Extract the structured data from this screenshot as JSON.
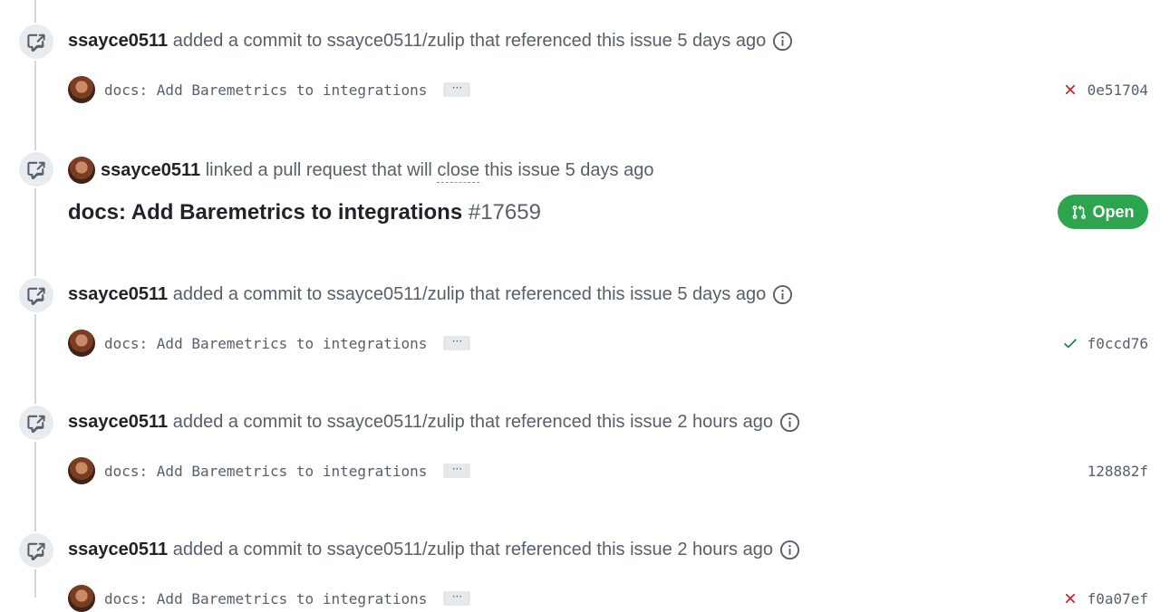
{
  "colors": {
    "success": "#2da44e",
    "danger": "#cf222e",
    "muted": "#57606a"
  },
  "events": [
    {
      "type": "commit-ref",
      "author": "ssayce0511",
      "action": "added a commit to",
      "repo": "ssayce0511/zulip",
      "suffix": "that referenced this issue",
      "time": "5 days ago",
      "commit": {
        "message": "docs: Add Baremetrics to integrations",
        "ellipsis": "···",
        "status": "failure",
        "sha": "0e51704"
      }
    },
    {
      "type": "linked-pr",
      "author": "ssayce0511",
      "action": "linked a pull request that will",
      "close_word": "close",
      "suffix": "this issue",
      "time": "5 days ago",
      "pr": {
        "title": "docs: Add Baremetrics to integrations",
        "number": "#17659",
        "state_label": "Open"
      }
    },
    {
      "type": "commit-ref",
      "author": "ssayce0511",
      "action": "added a commit to",
      "repo": "ssayce0511/zulip",
      "suffix": "that referenced this issue",
      "time": "5 days ago",
      "commit": {
        "message": "docs: Add Baremetrics to integrations",
        "ellipsis": "···",
        "status": "success",
        "sha": "f0ccd76"
      }
    },
    {
      "type": "commit-ref",
      "author": "ssayce0511",
      "action": "added a commit to",
      "repo": "ssayce0511/zulip",
      "suffix": "that referenced this issue",
      "time": "2 hours ago",
      "commit": {
        "message": "docs: Add Baremetrics to integrations",
        "ellipsis": "···",
        "status": "none",
        "sha": "128882f"
      }
    },
    {
      "type": "commit-ref",
      "author": "ssayce0511",
      "action": "added a commit to",
      "repo": "ssayce0511/zulip",
      "suffix": "that referenced this issue",
      "time": "2 hours ago",
      "commit": {
        "message": "docs: Add Baremetrics to integrations",
        "ellipsis": "···",
        "status": "failure",
        "sha": "f0a07ef"
      }
    }
  ]
}
